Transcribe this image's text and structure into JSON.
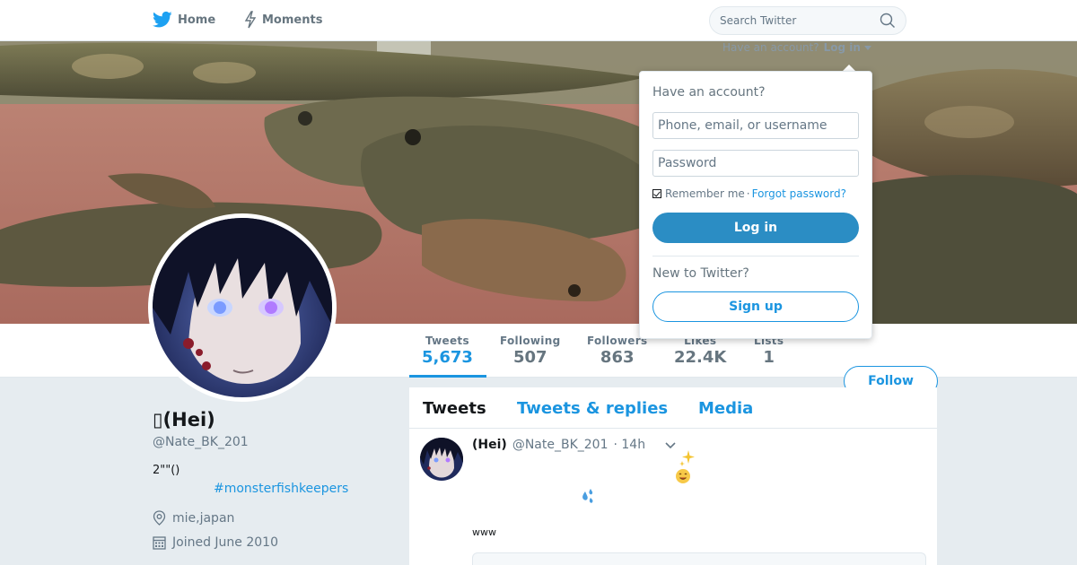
{
  "nav": {
    "home_label": "Home",
    "moments_label": "Moments",
    "search_placeholder": "Search Twitter"
  },
  "account_bar": {
    "prompt": "Have an account?",
    "login_label": "Log in"
  },
  "stats": [
    {
      "label": "Tweets",
      "value": "5,673"
    },
    {
      "label": "Following",
      "value": "507"
    },
    {
      "label": "Followers",
      "value": "863"
    },
    {
      "label": "Likes",
      "value": "22.4K"
    },
    {
      "label": "Lists",
      "value": "1"
    }
  ],
  "follow_label": "Follow",
  "profile": {
    "name": "▯(Hei)",
    "handle": "@Nate_BK_201",
    "bio": "2\"\"()",
    "hashtag": "#monsterfishkeepers",
    "location": "mie,japan",
    "joined": "Joined June 2010"
  },
  "timeline": {
    "tabs": [
      "Tweets",
      "Tweets & replies",
      "Media"
    ],
    "tweet": {
      "name": "(Hei)",
      "handle": "@Nate_BK_201",
      "time": "· 14h",
      "text": "www"
    }
  },
  "login_dropdown": {
    "title": "Have an account?",
    "username_placeholder": "Phone, email, or username",
    "password_placeholder": "Password",
    "remember_label": "Remember me",
    "separator": "·",
    "forgot_label": "Forgot password?",
    "login_button": "Log in",
    "new_prompt": "New to Twitter?",
    "signup_button": "Sign up"
  },
  "colors": {
    "accent": "#1b95e0",
    "login_button": "#2b8dc4",
    "background": "#e6ecf0"
  }
}
